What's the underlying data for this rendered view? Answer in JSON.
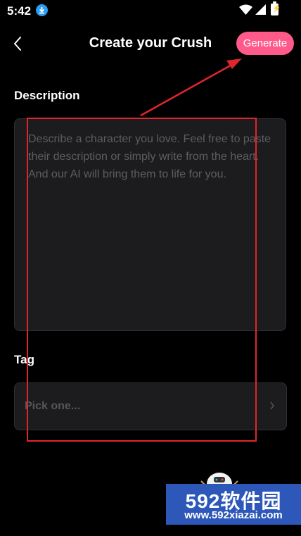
{
  "status_bar": {
    "time": "5:42",
    "icons": [
      "download-icon",
      "wifi-icon",
      "signal-icon",
      "battery-icon"
    ]
  },
  "header": {
    "title": "Create your Crush",
    "generate_label": "Generate",
    "back_icon": "chevron-left-icon"
  },
  "description": {
    "label": "Description",
    "placeholder": "Describe a character you love. Feel free to paste their description or simply write from the heart. And our AI will bring them to life for you."
  },
  "tag": {
    "label": "Tag",
    "placeholder": "Pick one...",
    "chevron_icon": "chevron-right-icon"
  },
  "watermark": {
    "brand": "592软件园",
    "url": "www.592xiazai.com"
  },
  "colors": {
    "background": "#000000",
    "accent": "#ff5a8a",
    "field_bg": "#1c1c1e",
    "placeholder": "#5d5d62",
    "annotation": "#e0262b",
    "watermark_bg": "#2d57b8"
  }
}
